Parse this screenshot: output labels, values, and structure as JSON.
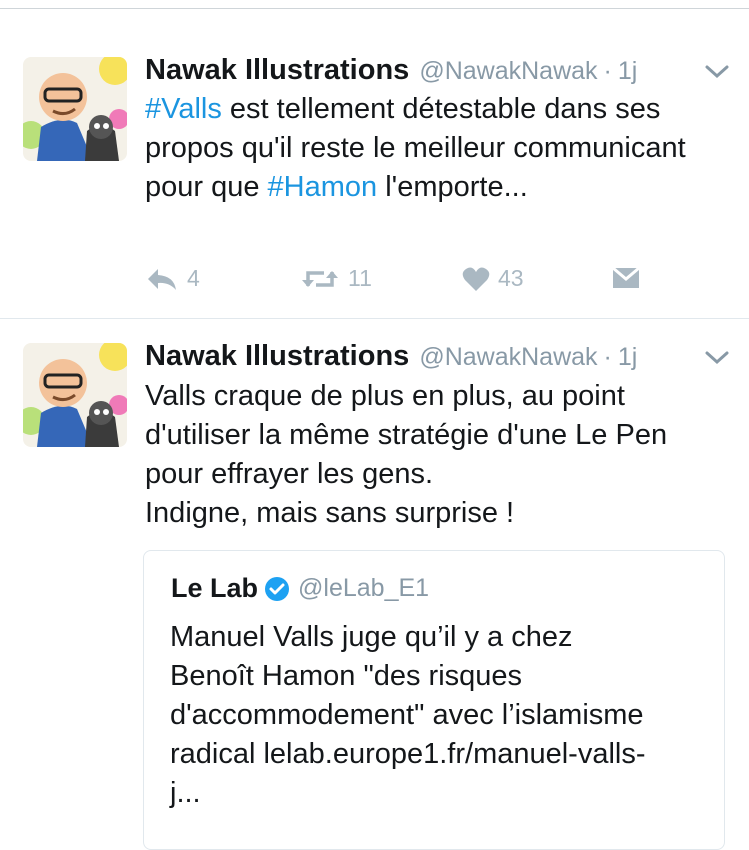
{
  "tweets": [
    {
      "author_name": "Nawak Illustrations",
      "author_handle": "@NawakNawak",
      "time": "1j",
      "text_parts": [
        "#Valls",
        " est tellement détestable dans ses propos qu'il reste le meilleur communicant pour que ",
        "#Hamon",
        " l'emporte..."
      ],
      "actions": {
        "reply": "4",
        "retweet": "11",
        "like": "43"
      }
    },
    {
      "author_name": "Nawak Illustrations",
      "author_handle": "@NawakNawak",
      "time": "1j",
      "text_lines": [
        "Valls craque de plus en plus, au point",
        "d'utiliser la même stratégie d'une Le Pen",
        "pour effrayer les gens.",
        "Indigne, mais sans surprise !"
      ],
      "quoted": {
        "author_name": "Le Lab",
        "author_handle": "@leLab_E1",
        "text_lines": [
          "Manuel Valls juge qu’il y a chez",
          "Benoît Hamon \"des risques",
          "d'accommodement\" avec l’islamisme",
          "radical lelab.europe1.fr/manuel-valls-",
          "j..."
        ]
      }
    }
  ],
  "icons": [
    "chevron-down-icon",
    "reply-icon",
    "retweet-icon",
    "heart-icon",
    "message-icon",
    "verified-badge-icon"
  ],
  "colors": {
    "link": "#1b95e0",
    "muted": "#8899a6",
    "action": "#aab8c2",
    "text": "#14171a"
  }
}
